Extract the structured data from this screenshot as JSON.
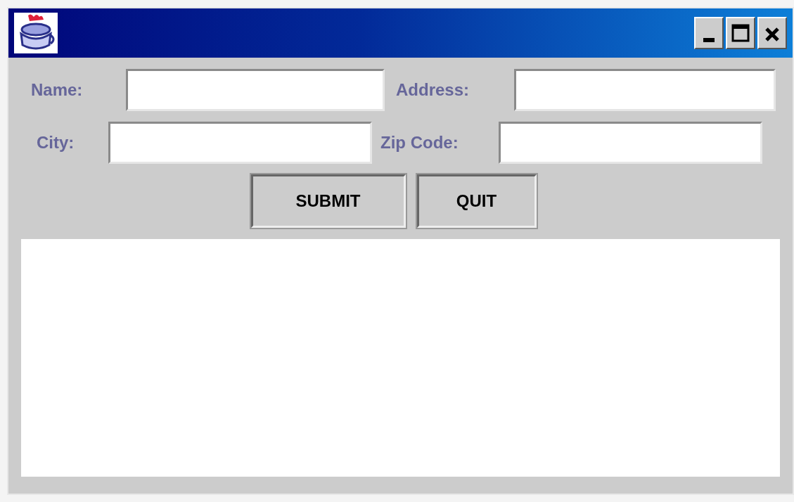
{
  "form_rows": [
    {
      "fields": [
        {
          "label": "Name:"
        },
        {
          "label": "Address:"
        }
      ]
    },
    {
      "fields": [
        {
          "label": "City:"
        },
        {
          "label": "Zip Code:"
        }
      ]
    }
  ],
  "buttons": [
    "SUBMIT",
    "QUIT"
  ]
}
